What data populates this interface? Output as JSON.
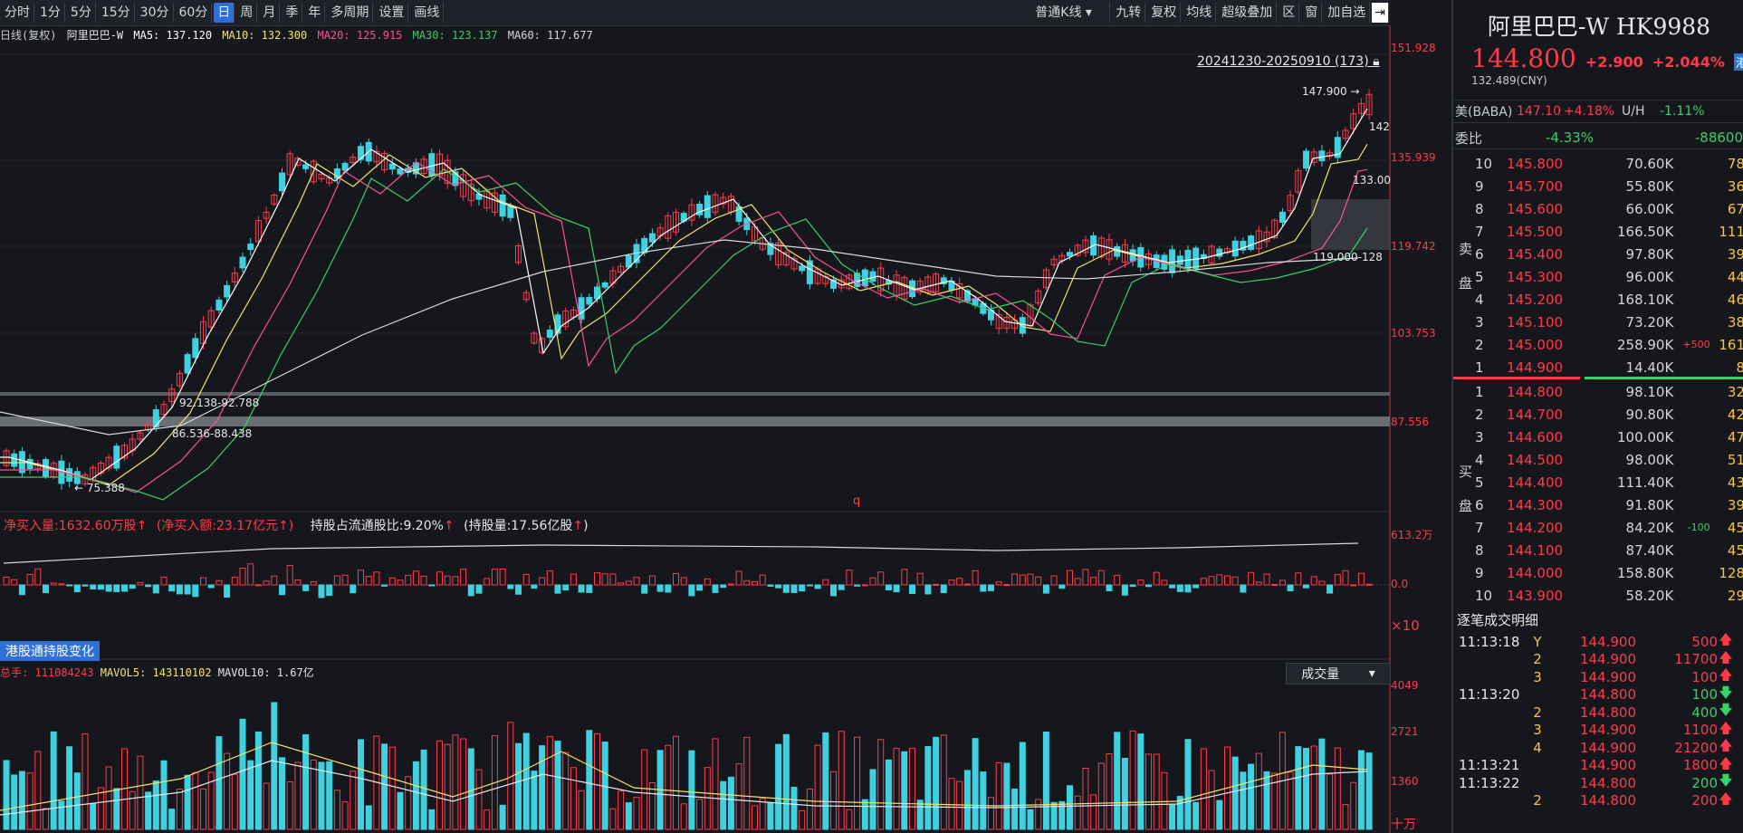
{
  "toolbar": {
    "periods": [
      "分时",
      "1分",
      "5分",
      "15分",
      "30分",
      "60分",
      "日",
      "周",
      "月",
      "季",
      "年",
      "多周期",
      "设置",
      "画线"
    ],
    "active_index": 6,
    "kline_type": "普通K线",
    "right_buttons": [
      "九转",
      "复权",
      "均线",
      "超级叠加",
      "区",
      "窗",
      "加自选"
    ]
  },
  "ma_info": {
    "prefix": "日线(复权)",
    "name": "阿里巴巴-W",
    "ma5": "MA5: 137.120",
    "ma10": "MA10: 132.300",
    "ma20": "MA20: 125.915",
    "ma30": "MA30: 123.137",
    "ma60": "MA60: 117.677"
  },
  "colors": {
    "up": "#ff3b4a",
    "down": "#3fd1e0",
    "ma5": "#ffffff",
    "ma10": "#f5e36a",
    "ma20": "#ff4f9a",
    "ma30": "#36d26a",
    "ma60": "#d8d8d8",
    "accent": "#2f6fd6"
  },
  "main_chart": {
    "range_label": "20241230-20250910 (173)",
    "high_mark": "147.900",
    "right_mark": "142",
    "mark_133": "133.00",
    "range_box": "119.000-128",
    "low_mark": "75.388",
    "zone1": "92.138-92.788",
    "zone2": "86.536-88.438",
    "y_ticks": [
      "151.928",
      "135.939",
      "119.742",
      "103.753",
      "87.556"
    ],
    "q_marker": "q"
  },
  "flow": {
    "net_buy": "净买入量:1632.60万股",
    "net_amt": "(净买入额:23.17亿元",
    "hold_ratio": "持股占流通股比:9.20%",
    "hold_amt": "(持股量:17.56亿股",
    "y_top": "613.2万",
    "y_zero": "0.0",
    "scale": "×10",
    "tag": "港股通持股变化"
  },
  "volume": {
    "total": "总手: 111084243",
    "mavol5": "MAVOL5: 143110102",
    "mavol10": "MAVOL10: 1.67亿",
    "selector": "成交量",
    "y_ticks": [
      "4049",
      "2721",
      "1360",
      "十万"
    ]
  },
  "quote": {
    "name": "阿里巴巴-W HK9988",
    "price": "144.800",
    "change": "+2.900",
    "change_pct": "+2.044%",
    "market_badge": "港",
    "cny": "132.489(CNY)",
    "us_label": "美(BABA)",
    "us_price": "147.10",
    "us_pct": "+4.18%",
    "uh_label": "U/H",
    "uh_value": "-1.11%",
    "wb_label": "委比",
    "wb_pct": "-4.33%",
    "wb_diff": "-88600",
    "sell_label": [
      "卖",
      "盘"
    ],
    "buy_label": [
      "买",
      "盘"
    ],
    "asks": [
      {
        "lv": "10",
        "price": "145.800",
        "vol": "70.60K",
        "chg": "",
        "tail": "78"
      },
      {
        "lv": "9",
        "price": "145.700",
        "vol": "55.80K",
        "chg": "",
        "tail": "36"
      },
      {
        "lv": "8",
        "price": "145.600",
        "vol": "66.00K",
        "chg": "",
        "tail": "67"
      },
      {
        "lv": "7",
        "price": "145.500",
        "vol": "166.50K",
        "chg": "",
        "tail": "111"
      },
      {
        "lv": "6",
        "price": "145.400",
        "vol": "97.80K",
        "chg": "",
        "tail": "39"
      },
      {
        "lv": "5",
        "price": "145.300",
        "vol": "96.00K",
        "chg": "",
        "tail": "44"
      },
      {
        "lv": "4",
        "price": "145.200",
        "vol": "168.10K",
        "chg": "",
        "tail": "46"
      },
      {
        "lv": "3",
        "price": "145.100",
        "vol": "73.20K",
        "chg": "",
        "tail": "38"
      },
      {
        "lv": "2",
        "price": "145.000",
        "vol": "258.90K",
        "chg": "+500",
        "tail": "161"
      },
      {
        "lv": "1",
        "price": "144.900",
        "vol": "14.40K",
        "chg": "",
        "tail": "8"
      }
    ],
    "bids": [
      {
        "lv": "1",
        "price": "144.800",
        "vol": "98.10K",
        "chg": "",
        "tail": "32"
      },
      {
        "lv": "2",
        "price": "144.700",
        "vol": "90.80K",
        "chg": "",
        "tail": "42"
      },
      {
        "lv": "3",
        "price": "144.600",
        "vol": "100.00K",
        "chg": "",
        "tail": "47"
      },
      {
        "lv": "4",
        "price": "144.500",
        "vol": "98.00K",
        "chg": "",
        "tail": "51"
      },
      {
        "lv": "5",
        "price": "144.400",
        "vol": "111.40K",
        "chg": "",
        "tail": "43"
      },
      {
        "lv": "6",
        "price": "144.300",
        "vol": "91.80K",
        "chg": "",
        "tail": "39"
      },
      {
        "lv": "7",
        "price": "144.200",
        "vol": "84.20K",
        "chg": "-100",
        "tail": "45"
      },
      {
        "lv": "8",
        "price": "144.100",
        "vol": "87.40K",
        "chg": "",
        "tail": "45"
      },
      {
        "lv": "9",
        "price": "144.000",
        "vol": "158.80K",
        "chg": "",
        "tail": "128"
      },
      {
        "lv": "10",
        "price": "143.900",
        "vol": "58.20K",
        "chg": "",
        "tail": "29"
      }
    ],
    "ticks_title": "逐笔成交明细",
    "ticks": [
      {
        "time": "11:13:18",
        "n": "Y",
        "price": "144.900",
        "vol": "500",
        "dir": "up"
      },
      {
        "time": "",
        "n": "2",
        "price": "144.900",
        "vol": "11700",
        "dir": "up"
      },
      {
        "time": "",
        "n": "3",
        "price": "144.900",
        "vol": "100",
        "dir": "up"
      },
      {
        "time": "11:13:20",
        "n": "",
        "price": "144.800",
        "vol": "100",
        "dir": "down"
      },
      {
        "time": "",
        "n": "2",
        "price": "144.800",
        "vol": "400",
        "dir": "down"
      },
      {
        "time": "",
        "n": "3",
        "price": "144.900",
        "vol": "1100",
        "dir": "up"
      },
      {
        "time": "",
        "n": "4",
        "price": "144.900",
        "vol": "21200",
        "dir": "up"
      },
      {
        "time": "11:13:21",
        "n": "",
        "price": "144.900",
        "vol": "1800",
        "dir": "up"
      },
      {
        "time": "11:13:22",
        "n": "",
        "price": "144.800",
        "vol": "200",
        "dir": "down"
      },
      {
        "time": "",
        "n": "2",
        "price": "144.800",
        "vol": "200",
        "dir": "up"
      }
    ]
  }
}
